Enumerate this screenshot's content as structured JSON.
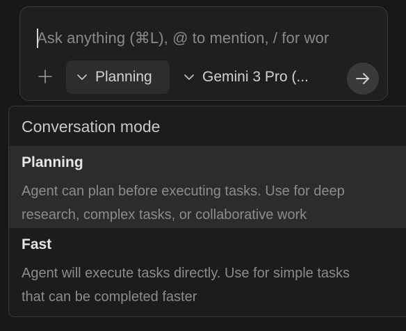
{
  "composer": {
    "placeholder": "Ask anything (⌘L), @ to mention, / for wor",
    "mode_button_label": "Planning",
    "model_button_label": "Gemini 3 Pro (...",
    "icons": {
      "add": "plus-icon",
      "mode_chevron": "chevron-down-icon",
      "model_chevron": "chevron-down-icon",
      "send": "arrow-right-icon"
    }
  },
  "dropdown": {
    "title": "Conversation mode",
    "options": [
      {
        "name": "Planning",
        "description": "Agent can plan before executing tasks. Use for deep\nresearch, complex tasks, or collaborative work",
        "selected": true
      },
      {
        "name": "Fast",
        "description": "Agent will execute tasks directly. Use for simple tasks\nthat can be completed faster",
        "selected": false
      }
    ]
  },
  "colors": {
    "background": "#181818",
    "panel": "#1f1f1f",
    "selected_row": "#2c2c2c",
    "text_primary": "#e6e6e6",
    "text_secondary": "#8c8c8c"
  }
}
